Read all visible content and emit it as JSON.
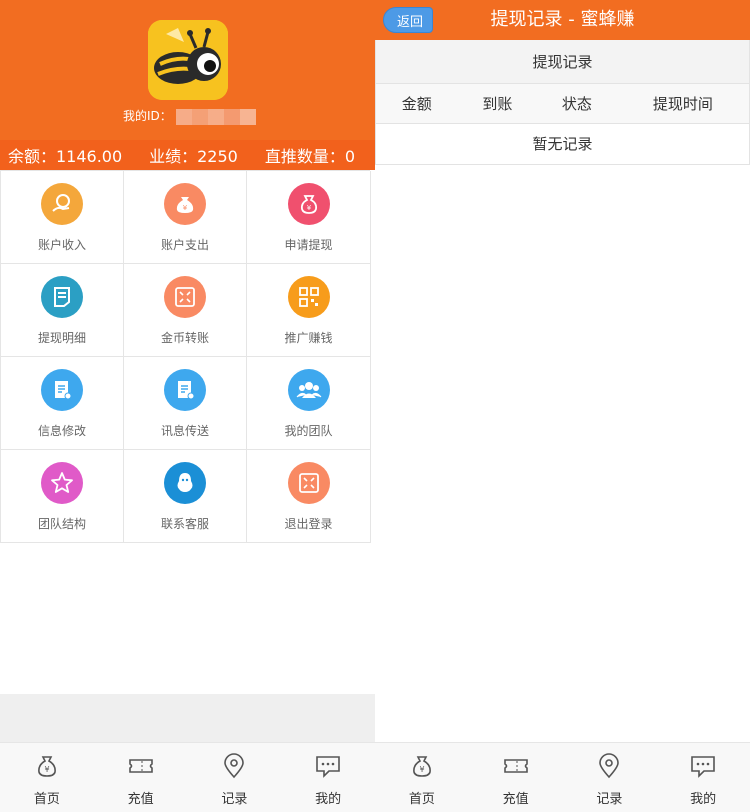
{
  "left": {
    "id_label": "我的ID：",
    "stats": {
      "balance": "余额：1146.00",
      "performance": "业绩：2250",
      "direct": "直推数量：0"
    },
    "menu": [
      {
        "label": "账户收入",
        "icon": "coin-hand-icon",
        "color": "#f4a73b"
      },
      {
        "label": "账户支出",
        "icon": "money-bag-icon",
        "color": "#f98a63"
      },
      {
        "label": "申请提现",
        "icon": "yuan-bag-icon",
        "color": "#f0506e"
      },
      {
        "label": "提现明细",
        "icon": "document-icon",
        "color": "#2b9fc4"
      },
      {
        "label": "金币转账",
        "icon": "transfer-icon",
        "color": "#f98a63"
      },
      {
        "label": "推广赚钱",
        "icon": "qr-code-icon",
        "color": "#f79c1b"
      },
      {
        "label": "信息修改",
        "icon": "edit-doc-icon",
        "color": "#3ea8ee"
      },
      {
        "label": "讯息传送",
        "icon": "message-doc-icon",
        "color": "#3ea8ee"
      },
      {
        "label": "我的团队",
        "icon": "team-icon",
        "color": "#3ea8ee"
      },
      {
        "label": "团队结构",
        "icon": "star-icon",
        "color": "#e05ac8"
      },
      {
        "label": "联系客服",
        "icon": "qq-icon",
        "color": "#1b8fd6"
      },
      {
        "label": "退出登录",
        "icon": "logout-icon",
        "color": "#f98a63"
      }
    ]
  },
  "right": {
    "back_label": "返回",
    "title": "提现记录 - 蜜蜂赚",
    "table": {
      "caption": "提现记录",
      "headers": [
        "金额",
        "到账",
        "状态",
        "提现时间"
      ],
      "empty": "暂无记录"
    }
  },
  "nav": [
    {
      "label": "首页",
      "icon": "money-bag-icon"
    },
    {
      "label": "充值",
      "icon": "ticket-icon"
    },
    {
      "label": "记录",
      "icon": "location-pin-icon"
    },
    {
      "label": "我的",
      "icon": "chat-bubble-icon"
    }
  ],
  "colors": {
    "brand": "#f26d21",
    "back_button": "#4d9ae6"
  }
}
